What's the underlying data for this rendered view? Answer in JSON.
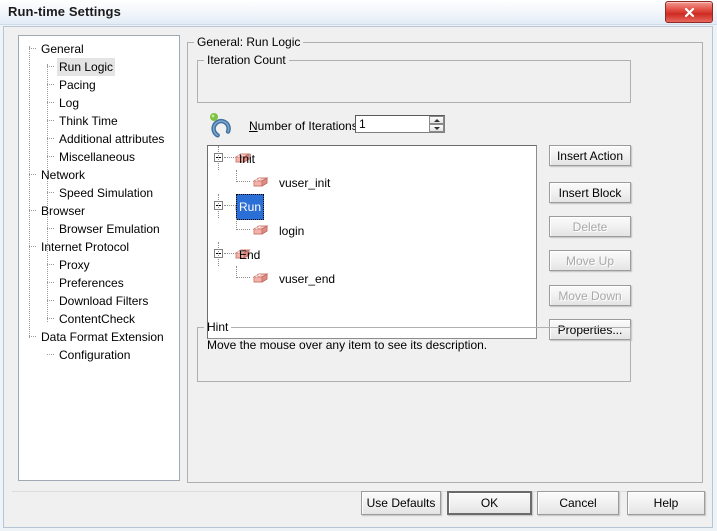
{
  "window": {
    "title": "Run-time Settings",
    "close_label": "×",
    "close_icon": "close-icon"
  },
  "sidebar": {
    "items": [
      {
        "label": "General",
        "level": 0,
        "selected": false
      },
      {
        "label": "Run Logic",
        "level": 1,
        "selected": true
      },
      {
        "label": "Pacing",
        "level": 1,
        "selected": false
      },
      {
        "label": "Log",
        "level": 1,
        "selected": false
      },
      {
        "label": "Think Time",
        "level": 1,
        "selected": false
      },
      {
        "label": "Additional attributes",
        "level": 1,
        "selected": false
      },
      {
        "label": "Miscellaneous",
        "level": 1,
        "selected": false
      },
      {
        "label": "Network",
        "level": 0,
        "selected": false
      },
      {
        "label": "Speed Simulation",
        "level": 1,
        "selected": false
      },
      {
        "label": "Browser",
        "level": 0,
        "selected": false
      },
      {
        "label": "Browser Emulation",
        "level": 1,
        "selected": false
      },
      {
        "label": "Internet Protocol",
        "level": 0,
        "selected": false
      },
      {
        "label": "Proxy",
        "level": 1,
        "selected": false
      },
      {
        "label": "Preferences",
        "level": 1,
        "selected": false
      },
      {
        "label": "Download Filters",
        "level": 1,
        "selected": false
      },
      {
        "label": "ContentCheck",
        "level": 1,
        "selected": false
      },
      {
        "label": "Data Format Extension",
        "level": 0,
        "selected": false
      },
      {
        "label": "Configuration",
        "level": 1,
        "selected": false
      }
    ]
  },
  "main": {
    "group_title": "General: Run Logic",
    "iteration": {
      "group_title": "Iteration Count",
      "icon": "loop-iteration-icon",
      "field_label_pre": "N",
      "field_label_post": "umber of Iterations:",
      "value": "1",
      "placeholder": ""
    },
    "run_logic_tree": [
      {
        "label": "Init",
        "level": 0,
        "expanded": true,
        "selected": false,
        "icon": "action-block-icon"
      },
      {
        "label": "vuser_init",
        "level": 1,
        "expanded": false,
        "selected": false,
        "icon": "action-block-icon"
      },
      {
        "label": "Run",
        "level": 0,
        "expanded": true,
        "selected": true,
        "icon": "action-block-icon"
      },
      {
        "label": "login",
        "level": 1,
        "expanded": false,
        "selected": false,
        "icon": "action-block-icon"
      },
      {
        "label": "End",
        "level": 0,
        "expanded": true,
        "selected": false,
        "icon": "action-block-icon"
      },
      {
        "label": "vuser_end",
        "level": 1,
        "expanded": false,
        "selected": false,
        "icon": "action-block-icon"
      }
    ],
    "side_buttons": [
      {
        "pre": "I",
        "accel": "",
        "label_a": "I",
        "label_b": "nsert Action",
        "text": "Insert Action",
        "disabled": false,
        "underline_index": 0
      },
      {
        "label_a": "Insert ",
        "label_b": "B",
        "label_c": "lock",
        "text": "Insert Block",
        "disabled": false
      },
      {
        "text": "Delete",
        "disabled": true
      },
      {
        "text": "Move Up",
        "disabled": true
      },
      {
        "text": "Move Down",
        "disabled": true
      },
      {
        "text": "Properties...",
        "disabled": false
      }
    ],
    "hint": {
      "group_title": "Hint",
      "text": "Move the mouse over any item to see its description."
    }
  },
  "footer": {
    "buttons": [
      {
        "text": "Use Defaults",
        "default": false
      },
      {
        "text": "OK",
        "default": true
      },
      {
        "text": "Cancel",
        "default": false
      },
      {
        "text": "Help",
        "default": false
      }
    ]
  },
  "colors": {
    "selection_blue": "#2a6fd6",
    "close_red": "#cd2b22",
    "dialog_face": "#f0f0f0",
    "icon_salmon": "#f2a9a0",
    "icon_loop_blue": "#3f6f9f",
    "icon_dot_green": "#7dc242"
  }
}
